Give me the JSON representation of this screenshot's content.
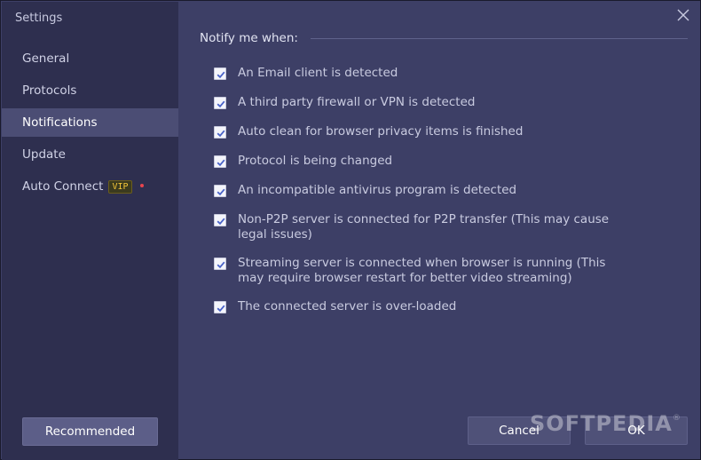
{
  "window": {
    "title": "Settings"
  },
  "sidebar": {
    "items": [
      {
        "label": "General"
      },
      {
        "label": "Protocols"
      },
      {
        "label": "Notifications",
        "active": true
      },
      {
        "label": "Update"
      },
      {
        "label": "Auto Connect",
        "badge": "VIP"
      }
    ],
    "recommended_label": "Recommended"
  },
  "notifications": {
    "header": "Notify me when:",
    "options": [
      {
        "label": "An Email client is detected",
        "checked": true
      },
      {
        "label": "A third party firewall or VPN is detected",
        "checked": true
      },
      {
        "label": "Auto clean for browser privacy items is finished",
        "checked": true
      },
      {
        "label": "Protocol is being changed",
        "checked": true
      },
      {
        "label": "An incompatible antivirus program is detected",
        "checked": true
      },
      {
        "label": "Non-P2P server is connected for P2P transfer (This may cause legal issues)",
        "checked": true
      },
      {
        "label": "Streaming server is connected when browser is running (This may require browser restart for better video streaming)",
        "checked": true
      },
      {
        "label": "The connected server is over-loaded",
        "checked": true
      }
    ]
  },
  "footer": {
    "cancel_label": "Cancel",
    "ok_label": "OK"
  },
  "watermark": {
    "text": "SOFTPEDIA",
    "mark": "®"
  },
  "icons": {
    "close": "close-icon",
    "checkbox": "checkmark-icon",
    "dot": "notification-dot-icon"
  },
  "colors": {
    "sidebar_bg": "#2e2f4f",
    "content_bg": "#3d3f66",
    "active_item_bg": "#4b4d74",
    "checkbox_check": "#4a63c8",
    "vip_badge": "#f2c438",
    "alert_dot": "#e8454e"
  }
}
